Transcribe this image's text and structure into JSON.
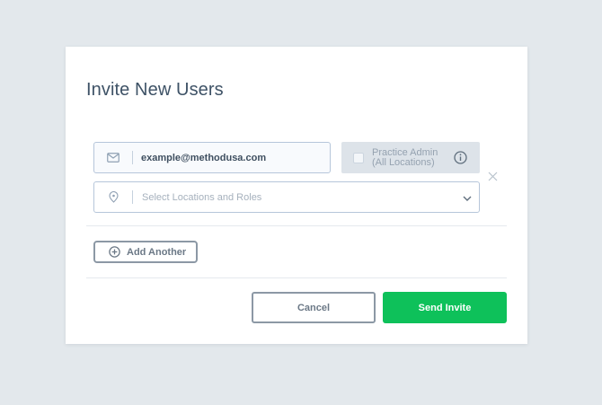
{
  "modal": {
    "title": "Invite New Users",
    "email_field": {
      "value": "example@methodusa.com",
      "icon": "envelope-icon"
    },
    "practice_admin": {
      "label_line1": "Practice Admin",
      "label_line2": "(All Locations)",
      "checked": false,
      "info_icon": "info-icon"
    },
    "remove_icon": "close-icon",
    "location_select": {
      "placeholder": "Select Locations and Roles",
      "icon": "location-pin-icon",
      "chevron": "chevron-down-icon"
    },
    "add_another": {
      "label": "Add Another",
      "icon": "plus-circle-icon"
    },
    "buttons": {
      "cancel": "Cancel",
      "send": "Send Invite"
    }
  },
  "colors": {
    "background": "#e3e8ec",
    "modal_bg": "#ffffff",
    "title": "#3e5266",
    "input_border": "#b6c6da",
    "primary_green": "#0ec15a",
    "secondary_border": "#8c98a5",
    "admin_box_bg": "#dde3e9"
  }
}
